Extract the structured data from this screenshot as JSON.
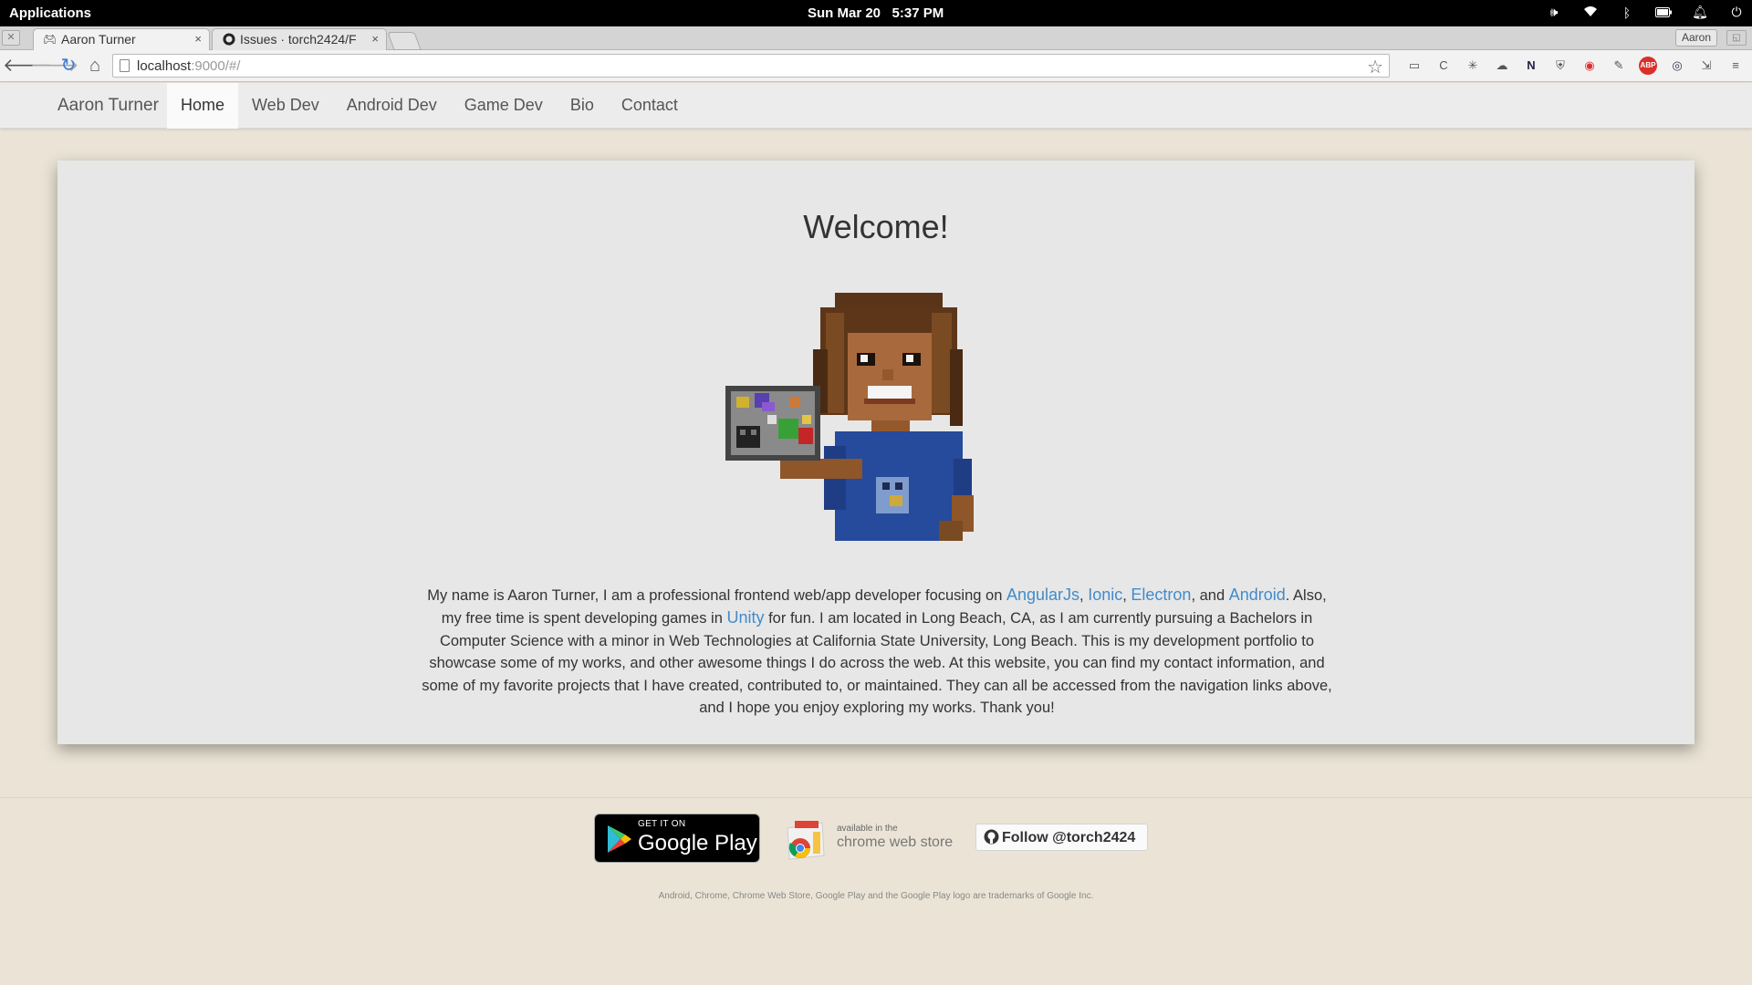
{
  "desktop": {
    "apps_label": "Applications",
    "date": "Sun Mar 20",
    "time": "5:37 PM"
  },
  "browser": {
    "tabs": [
      {
        "title": "Aaron Turner",
        "close": "×"
      },
      {
        "title": "Issues · torch2424/F",
        "close": "×"
      }
    ],
    "profile_name": "Aaron",
    "url_host": "localhost",
    "url_path": ":9000/#/"
  },
  "site": {
    "brand": "Aaron Turner",
    "nav": [
      "Home",
      "Web Dev",
      "Android Dev",
      "Game Dev",
      "Bio",
      "Contact"
    ],
    "active_nav": "Home",
    "welcome_title": "Welcome!",
    "intro": {
      "p1": "My name is Aaron Turner, I am a professional frontend web/app developer focusing on ",
      "link_angular": "AngularJs",
      "sep1": ", ",
      "link_ionic": "Ionic",
      "sep2": ", ",
      "link_electron": "Electron",
      "sep3": ", and ",
      "link_android": "Android",
      "p2": ". Also, my free time is spent developing games in ",
      "link_unity": "Unity",
      "p3": " for fun. I am located in Long Beach, CA, as I am currently pursuing a Bachelors in Computer Science with a minor in Web Technologies at California State University, Long Beach. This is my development portfolio to showcase some of my works, and other awesome things I do across the web. At this website, you can find my contact information, and some of my favorite projects that I have created, contributed to, or maintained. They can all be accessed from the navigation links above, and I hope you enjoy exploring my works. Thank you!"
    },
    "link_color": "#428bca"
  },
  "footer": {
    "gplay_small": "GET IT ON",
    "gplay_big": "Google Play",
    "cws_small": "available in the",
    "cws_big": "chrome web store",
    "follow": "Follow @torch2424",
    "trademark": "Android, Chrome, Chrome Web Store, Google Play and the Google Play logo are trademarks of Google Inc."
  },
  "icons": {
    "system": [
      "volume-icon",
      "wifi-icon",
      "bluetooth-icon",
      "battery-icon",
      "bell-icon",
      "power-icon"
    ],
    "extensions": [
      "cast-icon",
      "reload-ext-icon",
      "ext-icon",
      "ext-icon",
      "notion-icon",
      "shield-icon",
      "chrome-ext-icon",
      "eyedropper-icon",
      "adblock-icon",
      "ext-icon",
      "ext-icon",
      "menu-icon"
    ]
  }
}
